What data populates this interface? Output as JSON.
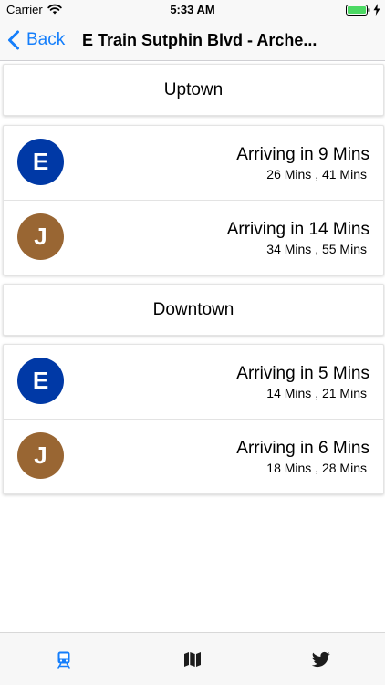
{
  "status_bar": {
    "carrier": "Carrier",
    "time": "5:33 AM"
  },
  "nav": {
    "back_label": "Back",
    "title": "E Train Sutphin Blvd - Arche..."
  },
  "sections": [
    {
      "title": "Uptown",
      "trains": [
        {
          "line": "E",
          "color": "#0039a6",
          "arrival": "Arriving in 9 Mins",
          "next": "26 Mins , 41 Mins"
        },
        {
          "line": "J",
          "color": "#996633",
          "arrival": "Arriving in 14 Mins",
          "next": "34 Mins , 55 Mins"
        }
      ]
    },
    {
      "title": "Downtown",
      "trains": [
        {
          "line": "E",
          "color": "#0039a6",
          "arrival": "Arriving in 5 Mins",
          "next": "14 Mins , 21 Mins"
        },
        {
          "line": "J",
          "color": "#996633",
          "arrival": "Arriving in 6 Mins",
          "next": "18 Mins , 28 Mins"
        }
      ]
    }
  ],
  "tab_bar": {
    "tabs": [
      {
        "icon": "train-icon",
        "active": true
      },
      {
        "icon": "map-icon",
        "active": false
      },
      {
        "icon": "twitter-icon",
        "active": false
      }
    ]
  },
  "colors": {
    "accent": "#147efb",
    "inactive_tab": "#1c1c1c",
    "battery": "#4cd964"
  }
}
